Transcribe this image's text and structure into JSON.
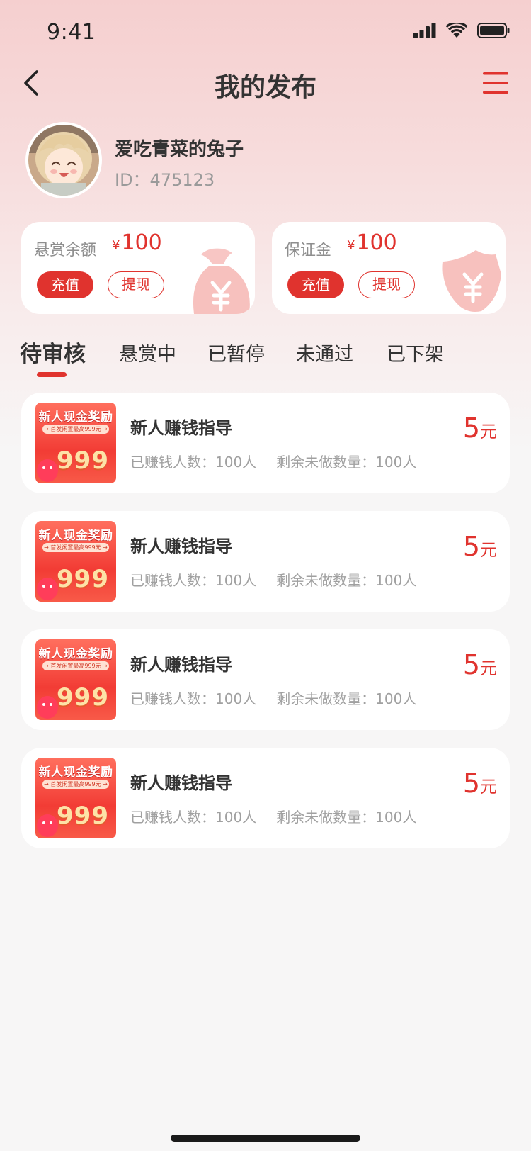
{
  "status_bar": {
    "time": "9:41"
  },
  "nav": {
    "title": "我的发布"
  },
  "profile": {
    "name": "爱吃青菜的兔子",
    "id_text": "ID：475123"
  },
  "balance_cards": [
    {
      "label": "悬赏余额",
      "currency": "¥",
      "amount": "100",
      "primary_action": "充值",
      "secondary_action": "提现",
      "deco_icon": "money-bag-icon"
    },
    {
      "label": "保证金",
      "currency": "¥",
      "amount": "100",
      "primary_action": "充值",
      "secondary_action": "提现",
      "deco_icon": "shield-yen-icon"
    }
  ],
  "tabs": [
    {
      "label": "待审核",
      "active": true
    },
    {
      "label": "悬赏中",
      "active": false
    },
    {
      "label": "已暂停",
      "active": false
    },
    {
      "label": "未通过",
      "active": false
    },
    {
      "label": "已下架",
      "active": false
    }
  ],
  "thumbnail": {
    "title": "新人现金奖励",
    "subtitle": "→ 首发闲置最高999元 →",
    "number": "999"
  },
  "tasks": [
    {
      "title": "新人赚钱指导",
      "earned": "已赚钱人数：100人",
      "remaining": "剩余未做数量：100人",
      "price": "5",
      "unit": "元"
    },
    {
      "title": "新人赚钱指导",
      "earned": "已赚钱人数：100人",
      "remaining": "剩余未做数量：100人",
      "price": "5",
      "unit": "元"
    },
    {
      "title": "新人赚钱指导",
      "earned": "已赚钱人数：100人",
      "remaining": "剩余未做数量：100人",
      "price": "5",
      "unit": "元"
    },
    {
      "title": "新人赚钱指导",
      "earned": "已赚钱人数：100人",
      "remaining": "剩余未做数量：100人",
      "price": "5",
      "unit": "元"
    }
  ],
  "colors": {
    "accent": "#e0332e",
    "background": "#f7f6f6",
    "header_gradient_top": "#f5cfcf"
  }
}
